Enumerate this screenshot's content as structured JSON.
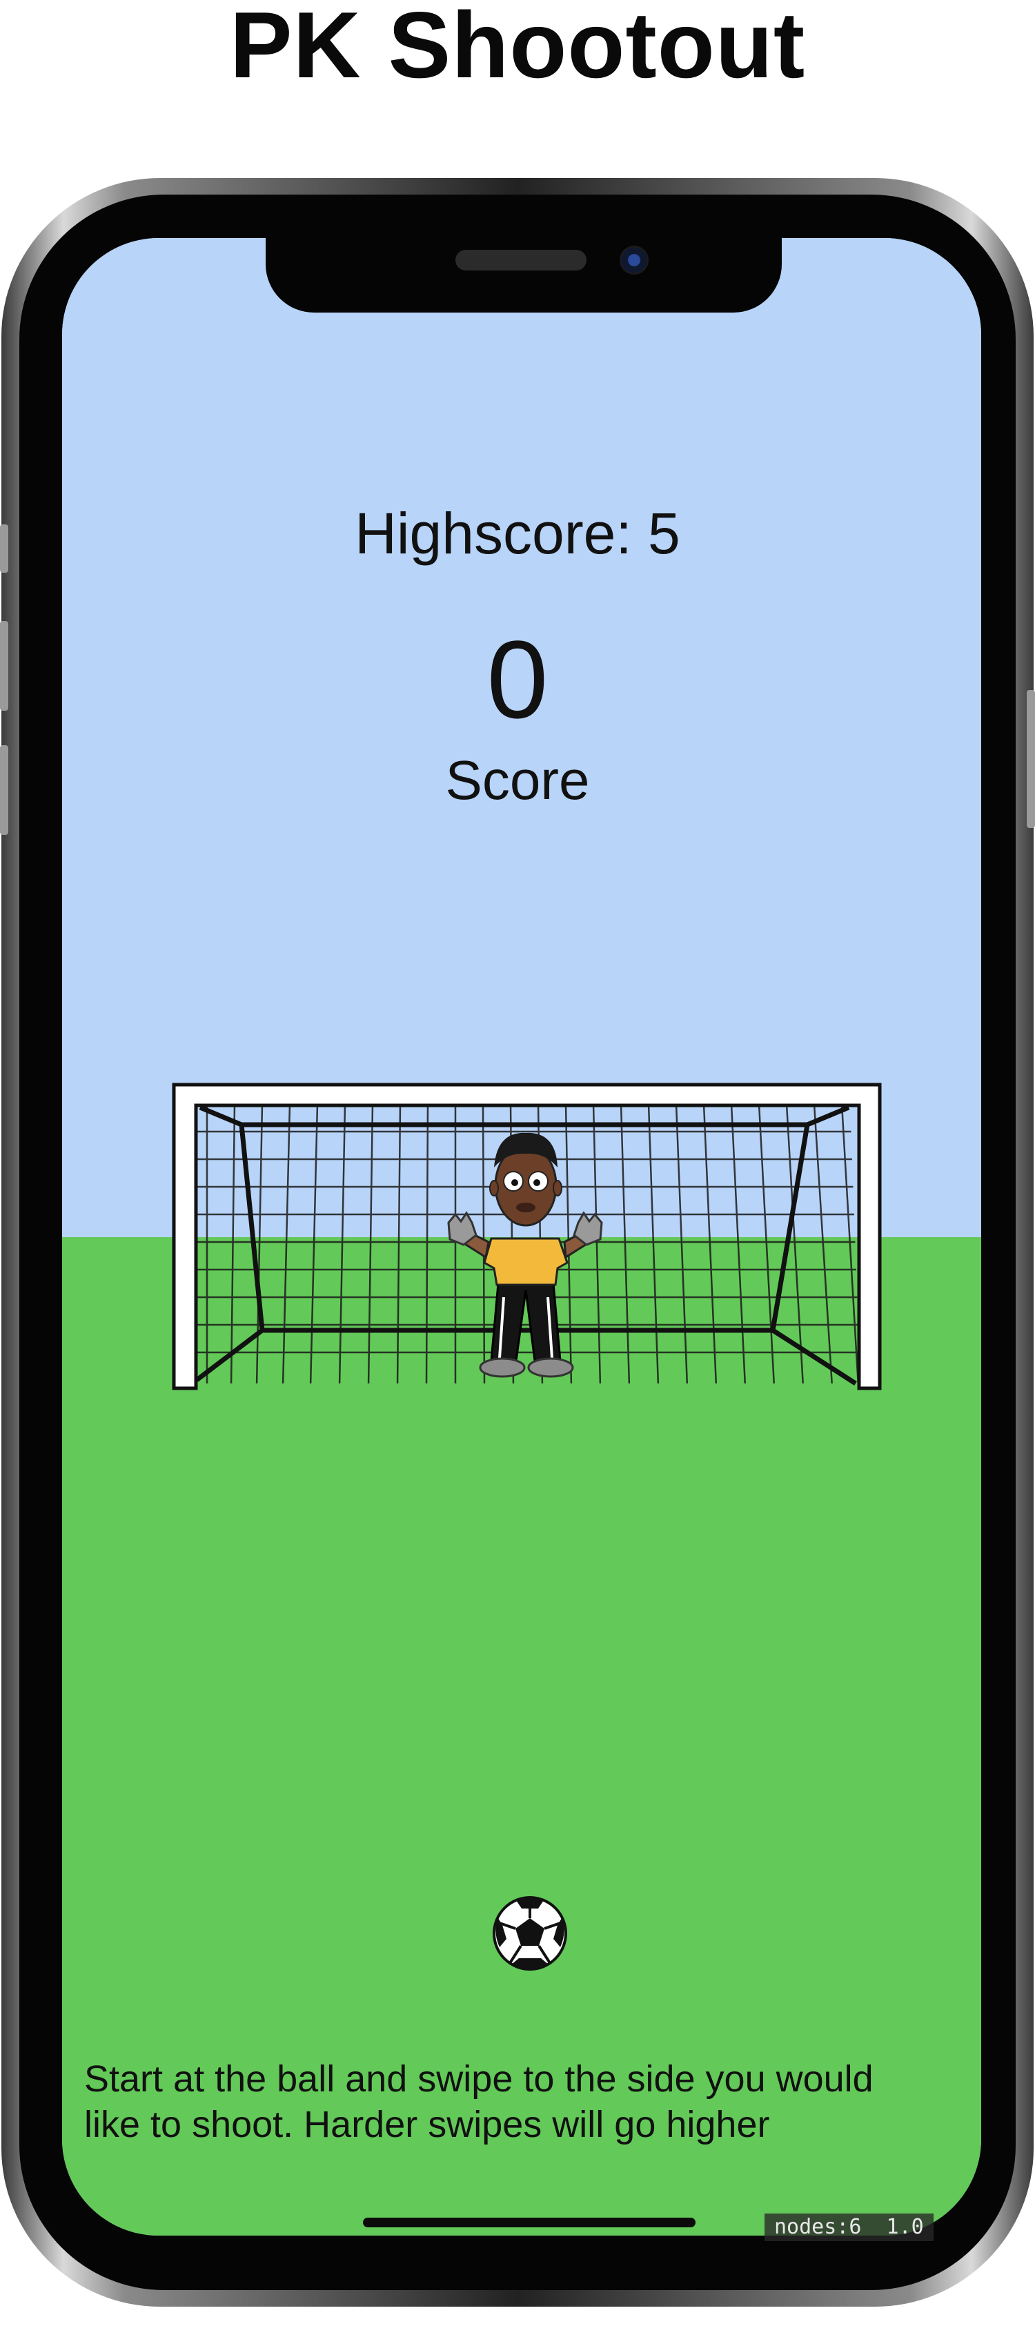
{
  "promo": {
    "title": "PK Shootout"
  },
  "game": {
    "highscore_label": "Highscore: 5",
    "score_value": "0",
    "score_label": "Score",
    "instructions": "Start at the ball and swipe to the side you would like to shoot.  Harder swipes will go higher",
    "debug_stats": "nodes:6  1.0"
  },
  "icons": {
    "goal": "soccer-goal-net",
    "goalkeeper": "goalkeeper-character",
    "ball": "soccer-ball-icon"
  },
  "colors": {
    "sky": "#b8d4f8",
    "grass": "#63c958",
    "keeper_shirt": "#f2b93b"
  }
}
